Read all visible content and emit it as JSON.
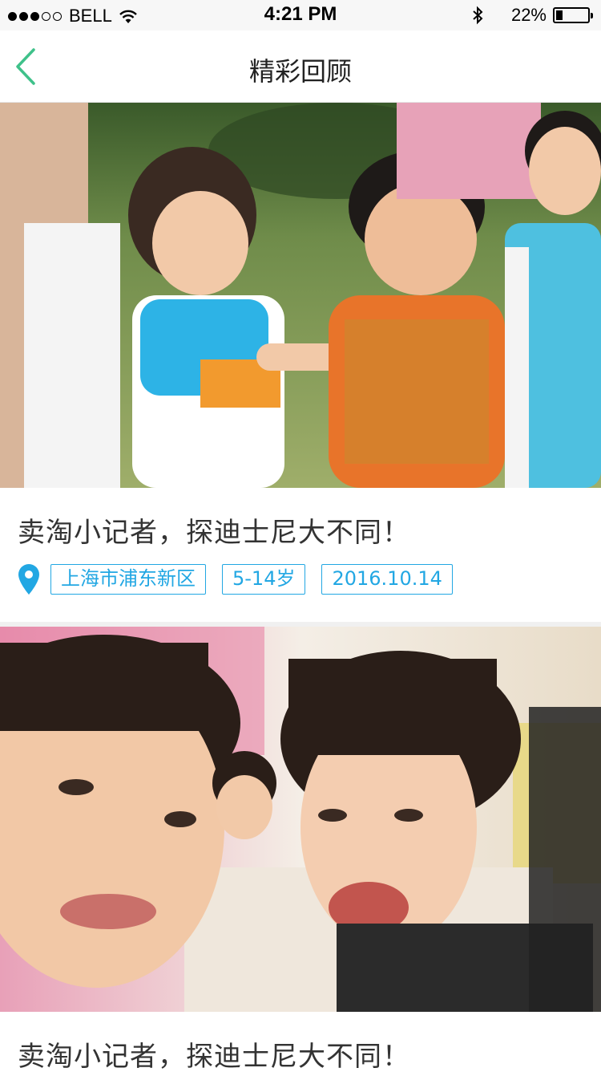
{
  "status_bar": {
    "carrier": "BELL",
    "time": "4:21 PM",
    "battery": "22%",
    "battery_level": 0.22,
    "signal_dots_filled": 3,
    "signal_dots_total": 5
  },
  "nav": {
    "title": "精彩回顾",
    "back_icon": "chevron-left-icon"
  },
  "colors": {
    "accent_green": "#3fc18a",
    "tag_blue": "#22a7e3"
  },
  "events": [
    {
      "title": "卖淘小记者，探迪士尼大不同！",
      "location": "上海市浦东新区",
      "age_range": "5-14岁",
      "date": "2016.10.14"
    },
    {
      "title": "卖淘小记者，探迪士尼大不同！"
    }
  ]
}
